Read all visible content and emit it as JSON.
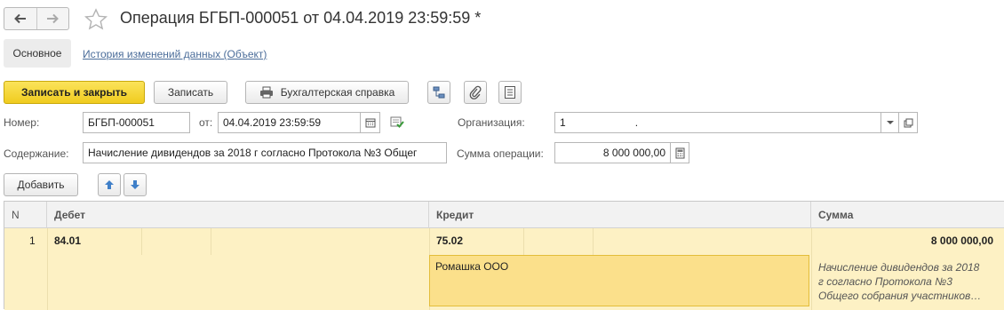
{
  "header": {
    "title": "Операция БГБП-000051 от 04.04.2019 23:59:59 *"
  },
  "tabs": {
    "main": "Основное",
    "history": "История изменений данных (Объект)"
  },
  "toolbar": {
    "save_close": "Записать и закрыть",
    "save": "Записать",
    "print": "Бухгалтерская справка"
  },
  "form": {
    "number_label": "Номер:",
    "number_value": "БГБП-000051",
    "date_label": "от:",
    "date_value": "04.04.2019 23:59:59",
    "org_label": "Организация:",
    "org_value": "1",
    "org_value_tail": ".",
    "content_label": "Содержание:",
    "content_value": "Начисление дивидендов за 2018 г согласно Протокола №3 Общег",
    "sum_label": "Сумма операции:",
    "sum_value": "8 000 000,00"
  },
  "table_toolbar": {
    "add": "Добавить"
  },
  "table": {
    "columns": [
      "N",
      "Дебет",
      "Кредит",
      "Сумма"
    ],
    "rows": [
      {
        "n": "1",
        "debit_account": "84.01",
        "credit_account": "75.02",
        "credit_subconto": "Ромашка ООО",
        "amount": "8 000 000,00",
        "comment_lines": [
          "Начисление дивидендов за 2018",
          "г согласно Протокола №3",
          "Общего собрания участников…"
        ]
      }
    ]
  },
  "colors": {
    "primary_button": "#f5d321",
    "row_highlight": "#fdf1c4",
    "selected_cell": "#fbe08b",
    "link": "#4b6d9a"
  }
}
